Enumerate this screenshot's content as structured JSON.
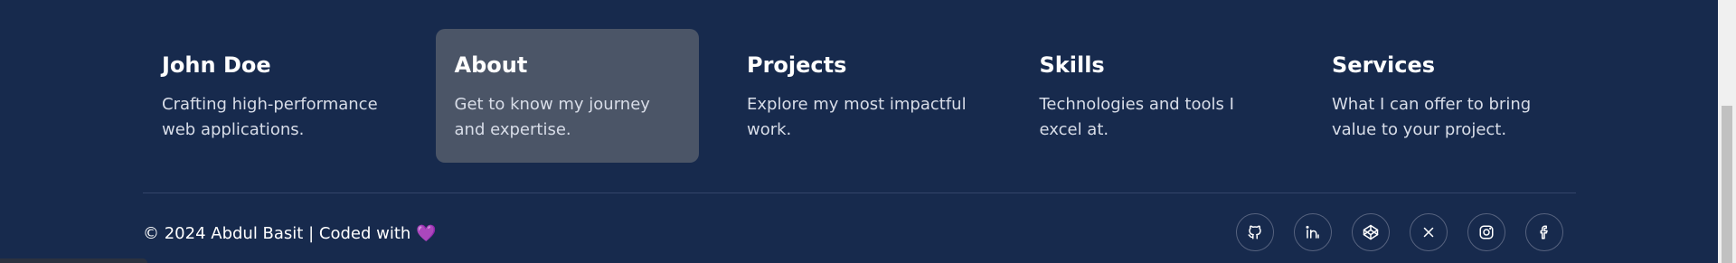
{
  "columns": [
    {
      "title": "John Doe",
      "desc": "Crafting high-performance web applications."
    },
    {
      "title": "About",
      "desc": "Get to know my journey and expertise."
    },
    {
      "title": "Projects",
      "desc": "Explore my most impactful work."
    },
    {
      "title": "Skills",
      "desc": "Technologies and tools I excel at."
    },
    {
      "title": "Services",
      "desc": "What I can offer to bring value to your project."
    }
  ],
  "footer": {
    "copyright": "© 2024 Abdul Basit | Coded with",
    "heart": "💜"
  },
  "socials": [
    "github-icon",
    "linkedin-icon",
    "codepen-icon",
    "x-icon",
    "instagram-icon",
    "facebook-icon"
  ],
  "colors": {
    "background": "#172a4d",
    "highlight": "#4b5567",
    "text": "#ffffff",
    "muted_text": "#d8dde8"
  }
}
